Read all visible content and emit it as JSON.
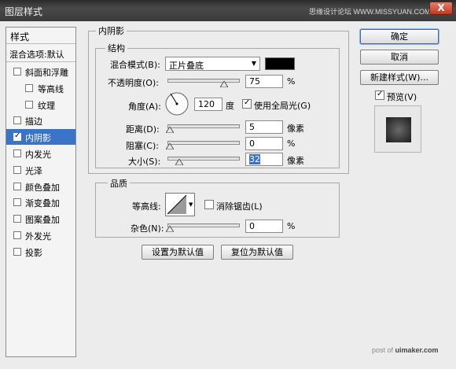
{
  "window": {
    "title": "图层样式",
    "watermark": "思缘设计论坛 WWW.MISSYUAN.COM",
    "close_glyph": "X"
  },
  "style_list": {
    "header": "样式",
    "blend_options": "混合选项:默认",
    "items": [
      {
        "label": "斜面和浮雕",
        "checked": false,
        "selected": false,
        "indent": false
      },
      {
        "label": "等高线",
        "checked": false,
        "selected": false,
        "indent": true
      },
      {
        "label": "纹理",
        "checked": false,
        "selected": false,
        "indent": true
      },
      {
        "label": "描边",
        "checked": false,
        "selected": false,
        "indent": false
      },
      {
        "label": "内阴影",
        "checked": true,
        "selected": true,
        "indent": false
      },
      {
        "label": "内发光",
        "checked": false,
        "selected": false,
        "indent": false
      },
      {
        "label": "光泽",
        "checked": false,
        "selected": false,
        "indent": false
      },
      {
        "label": "颜色叠加",
        "checked": false,
        "selected": false,
        "indent": false
      },
      {
        "label": "渐变叠加",
        "checked": false,
        "selected": false,
        "indent": false
      },
      {
        "label": "图案叠加",
        "checked": false,
        "selected": false,
        "indent": false
      },
      {
        "label": "外发光",
        "checked": false,
        "selected": false,
        "indent": false
      },
      {
        "label": "投影",
        "checked": false,
        "selected": false,
        "indent": false
      }
    ]
  },
  "inner_shadow": {
    "section_title": "内阴影",
    "structure": {
      "title": "结构",
      "blend_mode_label": "混合模式(B):",
      "blend_mode_value": "正片叠底",
      "shadow_color": "#000000",
      "opacity_label": "不透明度(O):",
      "opacity_value": "75",
      "opacity_unit": "%",
      "opacity_fraction": 0.75,
      "angle_label": "角度(A):",
      "angle_value": "120",
      "angle_unit": "度",
      "global_light_label": "使用全局光(G)",
      "global_light_checked": true,
      "distance_label": "距离(D):",
      "distance_value": "5",
      "distance_unit": "像素",
      "distance_fraction": 0.0,
      "choke_label": "阻塞(C):",
      "choke_value": "0",
      "choke_unit": "%",
      "choke_fraction": 0.0,
      "size_label": "大小(S):",
      "size_value": "32",
      "size_unit": "像素",
      "size_fraction": 0.13
    },
    "quality": {
      "title": "品质",
      "contour_label": "等高线:",
      "antialias_label": "消除锯齿(L)",
      "antialias_checked": false,
      "noise_label": "杂色(N):",
      "noise_value": "0",
      "noise_unit": "%",
      "noise_fraction": 0.0
    },
    "make_default_button": "设置为默认值",
    "reset_default_button": "复位为默认值"
  },
  "actions": {
    "ok": "确定",
    "cancel": "取消",
    "new_style": "新建样式(W)...",
    "preview_label": "预览(V)",
    "preview_checked": true
  },
  "footer_watermark_prefix": "post of ",
  "footer_watermark_brand": "uimaker.com",
  "colors": {
    "selected_bg": "#3b73c8",
    "dialog_bg": "#ececec"
  }
}
